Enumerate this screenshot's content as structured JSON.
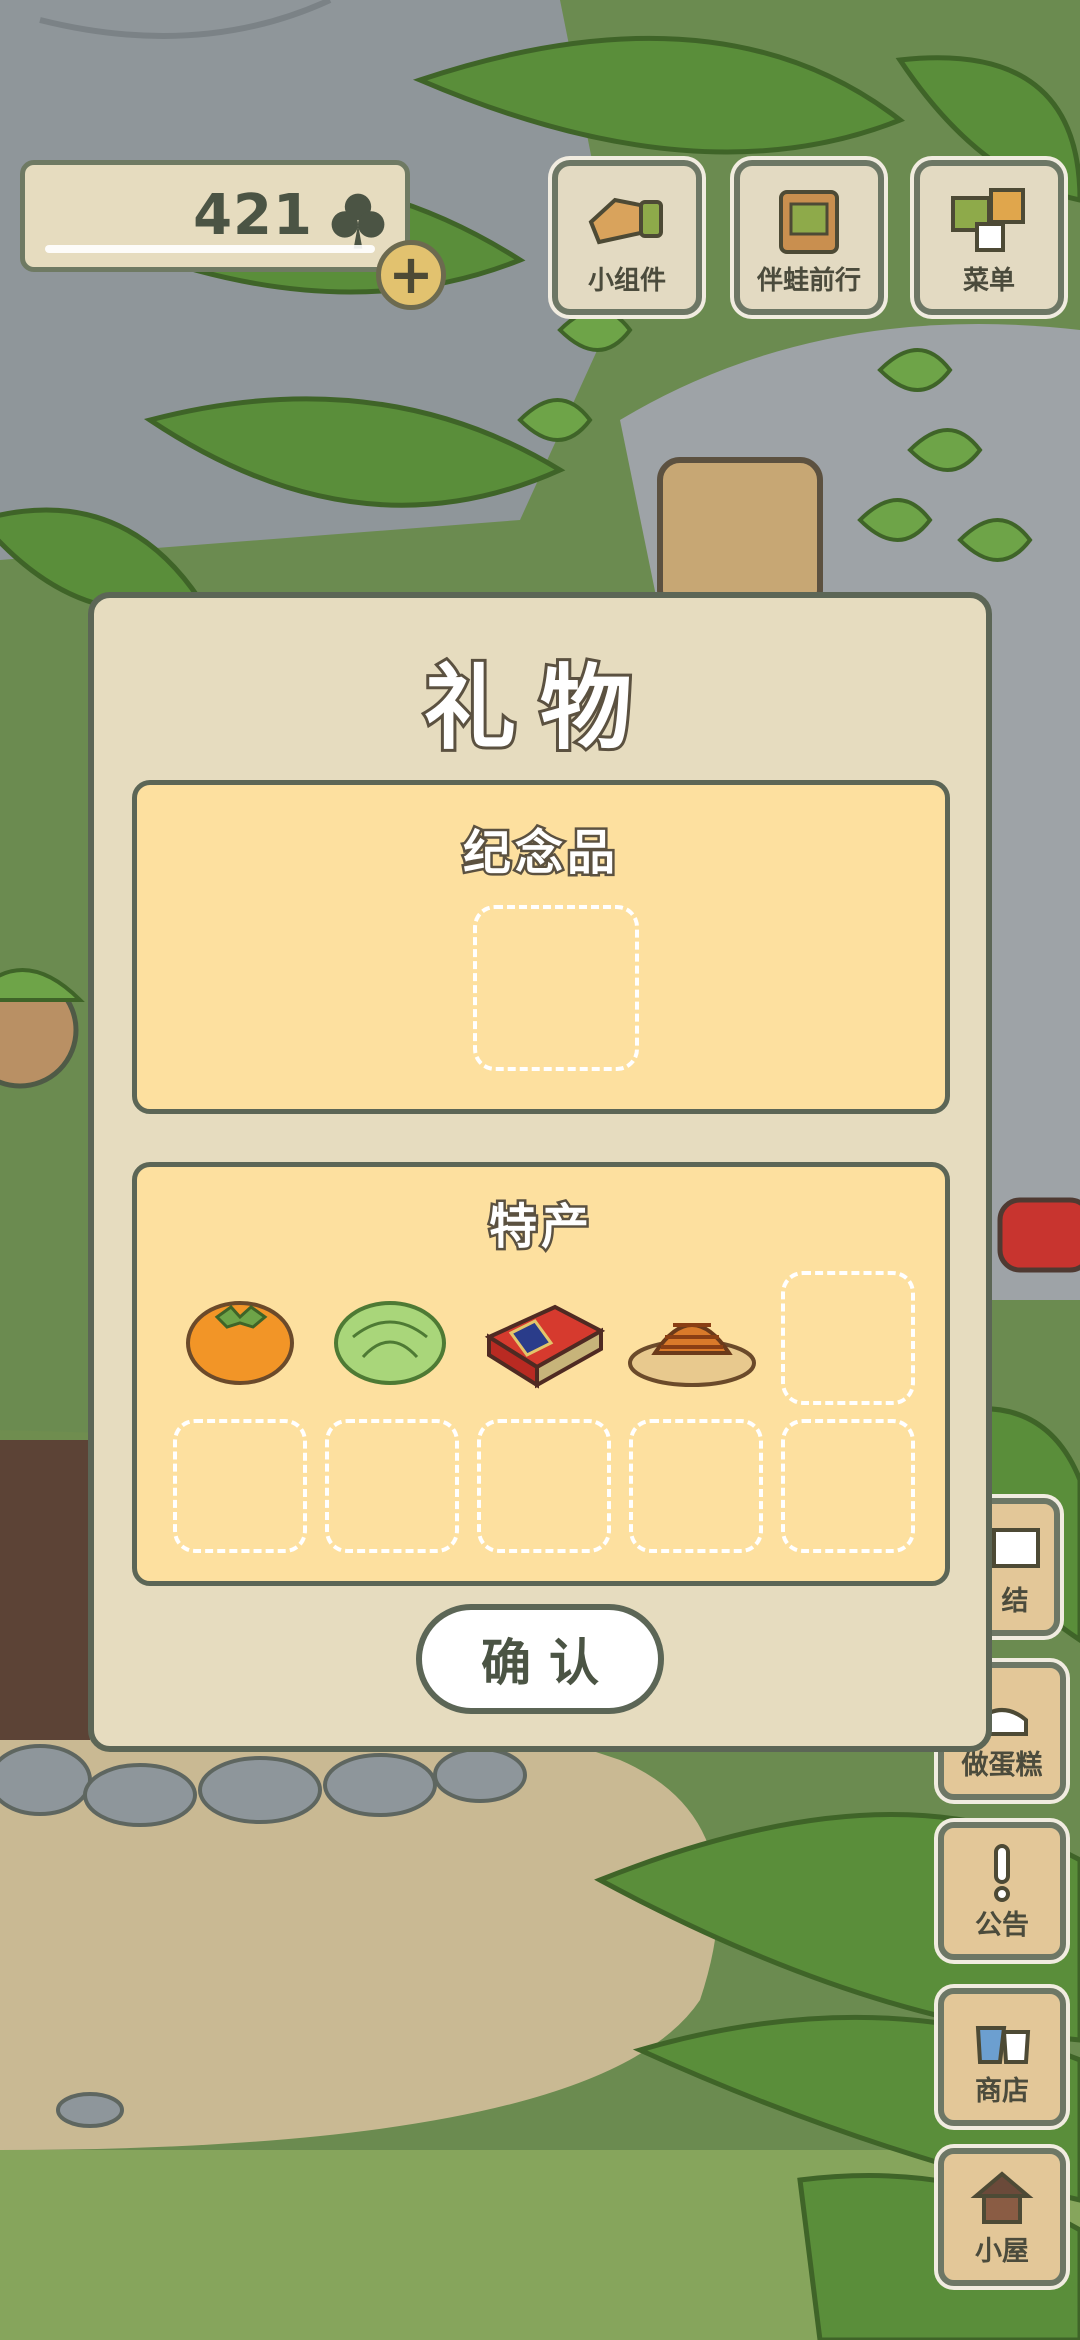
{
  "currency": {
    "amount": "421",
    "icon": "clover-icon",
    "add_icon": "plus-icon"
  },
  "top_menu": [
    {
      "label": "小组件",
      "icon": "widget-icon"
    },
    {
      "label": "伴蛙前行",
      "icon": "journey-book-icon"
    },
    {
      "label": "菜单",
      "icon": "menu-cards-icon"
    }
  ],
  "side_menu": [
    {
      "label": "结",
      "icon": "letter-icon"
    },
    {
      "label": "做蛋糕",
      "icon": "cake-icon"
    },
    {
      "label": "公告",
      "icon": "exclamation-icon"
    },
    {
      "label": "商店",
      "icon": "shop-bag-icon"
    },
    {
      "label": "小屋",
      "icon": "house-icon"
    }
  ],
  "gift_dialog": {
    "title": "礼物",
    "souvenir": {
      "title": "纪念品",
      "slots": 1
    },
    "specialty": {
      "title": "特产",
      "items": [
        {
          "name": "persimmon",
          "icon": "persimmon-icon"
        },
        {
          "name": "cabbage",
          "icon": "cabbage-icon"
        },
        {
          "name": "gift-box",
          "icon": "gift-box-icon"
        },
        {
          "name": "fried-dough",
          "icon": "fried-dough-icon"
        }
      ],
      "slots": 10
    },
    "confirm_label": "确认"
  }
}
